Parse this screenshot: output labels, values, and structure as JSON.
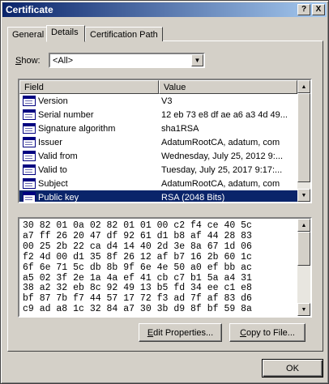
{
  "window": {
    "title": "Certificate",
    "help_glyph": "?",
    "close_glyph": "X"
  },
  "tabs": [
    {
      "label": "General",
      "active": false
    },
    {
      "label": "Details",
      "active": true
    },
    {
      "label": "Certification Path",
      "active": false
    }
  ],
  "show": {
    "label_prefix": "S",
    "label_rest": "how:",
    "selected": "<All>"
  },
  "fields_list": {
    "columns": [
      "Field",
      "Value"
    ],
    "rows": [
      {
        "field": "Version",
        "value": "V3"
      },
      {
        "field": "Serial number",
        "value": "12 eb 73 e8 df ae a6 a3 4d 49..."
      },
      {
        "field": "Signature algorithm",
        "value": "sha1RSA"
      },
      {
        "field": "Issuer",
        "value": "AdatumRootCA, adatum, com"
      },
      {
        "field": "Valid from",
        "value": "Wednesday, July 25, 2012 9:..."
      },
      {
        "field": "Valid to",
        "value": "Tuesday, July 25, 2017 9:17:..."
      },
      {
        "field": "Subject",
        "value": "AdatumRootCA, adatum, com"
      },
      {
        "field": "Public key",
        "value": "RSA (2048 Bits)",
        "selected": true
      }
    ]
  },
  "hex_dump": [
    "30 82 01 0a 02 82 01 01 00 c2 f4 ce 40 5c",
    "a7 ff 26 20 47 df 92 61 d1 b8 af 44 28 83",
    "00 25 2b 22 ca d4 14 40 2d 3e 8a 67 1d 06",
    "f2 4d 00 d1 35 8f 26 12 af b7 16 2b 60 1c",
    "6f 6e 71 5c db 8b 9f 6e 4e 50 a0 ef bb ac",
    "a5 02 3f 2e 1a 4a ef 41 cb c7 b1 5a a4 31",
    "38 a2 32 eb 8c 92 49 13 b5 fd 34 ee c1 e8",
    "bf 87 7b f7 44 57 17 72 f3 ad 7f af 83 d6",
    "c9 ad a8 1c 32 84 a7 30 3b d9 8f bf 59 8a"
  ],
  "buttons": {
    "edit_prefix": "E",
    "edit_rest": "dit Properties...",
    "copy_prefix": "C",
    "copy_rest": "opy to File...",
    "ok": "OK"
  }
}
